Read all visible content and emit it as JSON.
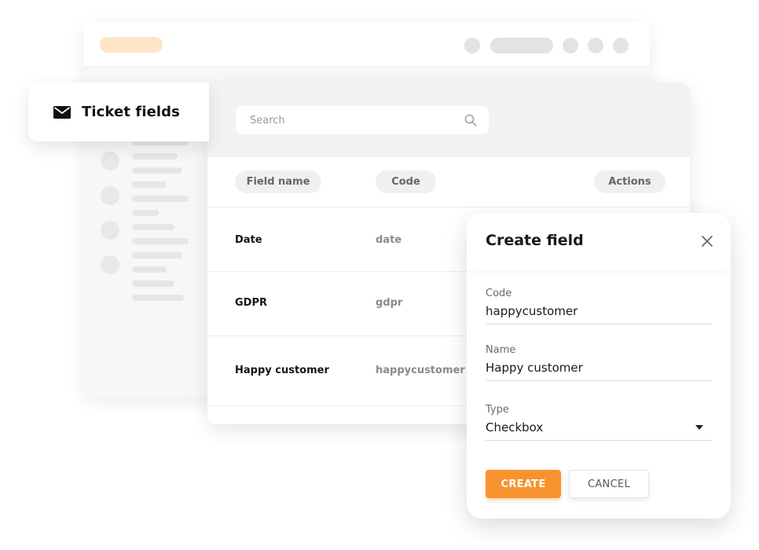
{
  "sidebar_tab": {
    "label": "Ticket fields",
    "icon": "envelope-icon"
  },
  "search": {
    "placeholder": "Search",
    "icon": "search-icon"
  },
  "table": {
    "columns": [
      "Field name",
      "Code",
      "Actions"
    ],
    "rows": [
      {
        "name": "Date",
        "code": "date"
      },
      {
        "name": "GDPR",
        "code": "gdpr"
      },
      {
        "name": "Happy customer",
        "code": "happycustomer"
      }
    ]
  },
  "dialog": {
    "title": "Create field",
    "close_icon": "close-icon",
    "fields": [
      {
        "label": "Code",
        "value": "happycustomer"
      },
      {
        "label": "Name",
        "value": "Happy customer"
      },
      {
        "label": "Type",
        "value": "Checkbox"
      }
    ],
    "create_label": "CREATE",
    "cancel_label": "CANCEL"
  },
  "colors": {
    "accent": "#f7932f",
    "accent_light": "#ffe4c8",
    "panel_gray": "#f2f2f2"
  }
}
